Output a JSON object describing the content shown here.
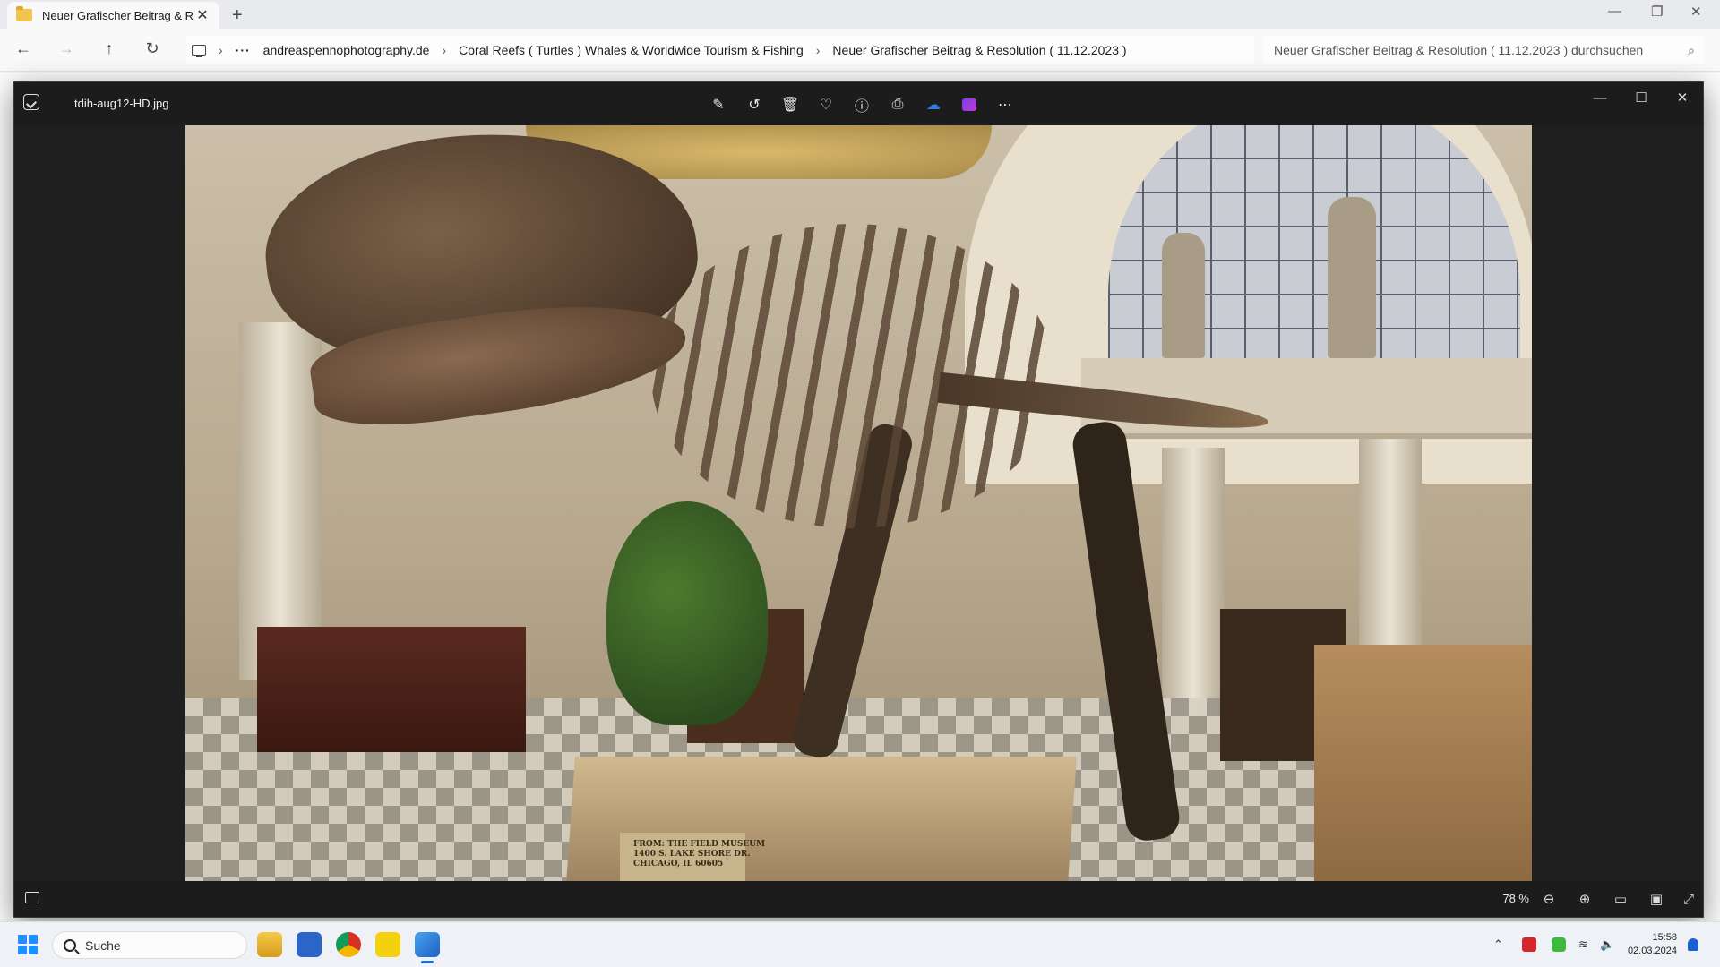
{
  "explorer": {
    "tab_title": "Neuer Grafischer Beitrag & Re",
    "breadcrumb": [
      "andreaspennophotography.de",
      "Coral Reefs ( Turtles ) Whales & Worldwide Tourism & Fishing",
      "Neuer Grafischer Beitrag & Resolution ( 11.12.2023 )"
    ],
    "breadcrumb_overflow": "···",
    "search_placeholder": "Neuer Grafischer Beitrag & Resolution ( 11.12.2023 ) durchsuchen"
  },
  "viewer": {
    "filename": "tdih-aug12-HD.jpg",
    "toolbar": [
      "edit-icon",
      "rotate-icon",
      "delete-icon",
      "favorite-icon",
      "info-icon",
      "print-icon",
      "onedrive-icon",
      "clipchamp-icon",
      "more-icon"
    ],
    "zoom": "78 %",
    "photo_sign_text": [
      "FROM: THE FIELD MUSEUM",
      "1400 S. LAKE SHORE DR.",
      "CHICAGO, IL 60605"
    ]
  },
  "taskbar": {
    "search_label": "Suche",
    "time": "15:58",
    "date": "02.03.2024",
    "apps": [
      "file-explorer",
      "microsoft-store",
      "chrome",
      "player",
      "photos"
    ]
  },
  "colors": {
    "viewer_bg": "#202020",
    "accent": "#1e6fd9"
  }
}
